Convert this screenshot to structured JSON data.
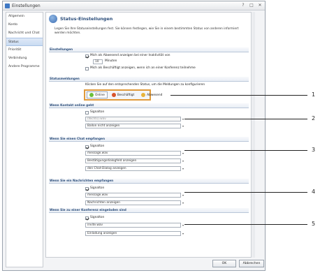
{
  "window": {
    "title": "Einstellungen",
    "controls": [
      "?",
      "□",
      "✕"
    ]
  },
  "sidebar": {
    "items": [
      {
        "label": "Allgemein"
      },
      {
        "label": "Konto"
      },
      {
        "label": "Nachricht und Chat"
      },
      {
        "label": "Status",
        "selected": true
      },
      {
        "label": "Priorität"
      },
      {
        "label": "Verbindung"
      },
      {
        "label": "Andere Programme"
      }
    ]
  },
  "panel": {
    "title": "Status-Einstellungen",
    "description": "Legen Sie Ihre Statuseinstellungen fest. Sie können festlegen, wie Sie in einem bestimmten Status von anderen informiert werden möchten."
  },
  "settings": {
    "header": "Einstellungen",
    "away_label": "Mich als Abwesend anzeigen bei einer Inaktivität von",
    "away_minutes": "10",
    "minutes_label": "Minuten",
    "busy_label": "Mich als Beschäftigt anzeigen, wenn ich an einer Konferenz teilnehme"
  },
  "status_msgs": {
    "header": "Statusmeldungen",
    "hint": "Klicken Sie auf den entsprechenden Status, um die Meldungen zu konfigurieren",
    "tabs": [
      {
        "label": "Online",
        "color": "#6bbf3a"
      },
      {
        "label": "Beschäftigt",
        "color": "#d9542b"
      },
      {
        "label": "Abwesend",
        "color": "#e8b43a"
      }
    ]
  },
  "sections": [
    {
      "header": "Wenn Kontakt online geht",
      "signal_label": "Signalton",
      "signal_checked": false,
      "sound": "(Nichts).wav",
      "sound_disabled": true,
      "action": "Ballon nicht anzeigen"
    },
    {
      "header": "Wenn Sie einen Chat empfangen",
      "signal_label": "Signalton",
      "signal_checked": true,
      "sound": "message.wav",
      "sound_disabled": false,
      "action": "Bestätigungsdialogfeld anzeigen",
      "action2": "den Chat-Dialog anzeigen"
    },
    {
      "header": "Wenn Sie ein Nachrichten empfangen",
      "signal_label": "Signalton",
      "signal_checked": true,
      "sound": "message.wav",
      "sound_disabled": false,
      "action": "Nachrichten anzeigen"
    },
    {
      "header": "Wenn Sie zu einer Konferenz eingeladen sind",
      "signal_label": "Signalton",
      "signal_checked": true,
      "sound": "invite.wav",
      "sound_disabled": false,
      "action": "Einladung anzeigen"
    }
  ],
  "callouts": [
    "1",
    "2",
    "3",
    "4",
    "5"
  ],
  "buttons": {
    "ok": "OK",
    "cancel": "Abbrechen"
  }
}
